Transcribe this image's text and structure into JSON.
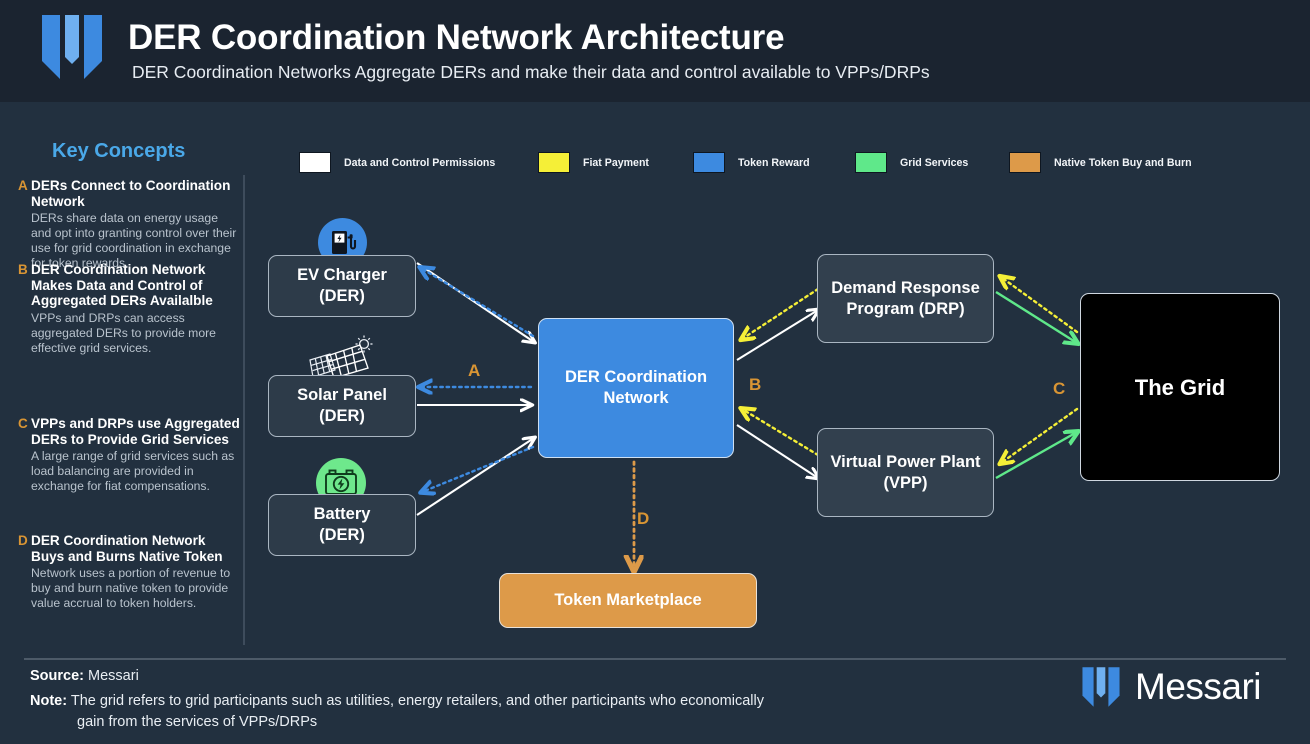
{
  "header": {
    "title": "DER Coordination Network Architecture",
    "subtitle": "DER Coordination Networks Aggregate DERs and make their data and control available to VPPs/DRPs",
    "logo_icon": "messari-logo-icon"
  },
  "sidebar": {
    "title": "Key Concepts",
    "concepts": [
      {
        "letter": "A",
        "heading": "DERs Connect to Coordination Network",
        "body": "DERs share data on energy usage and opt into granting control over their use for grid coordination in exchange for token rewards."
      },
      {
        "letter": "B",
        "heading": "DER Coordination Network Makes Data and Control of Aggregated DERs Availalble",
        "body": "VPPs and DRPs can access aggregated DERs to provide more effective grid services."
      },
      {
        "letter": "C",
        "heading": "VPPs and DRPs use Aggregated DERs to Provide Grid Services",
        "body": "A large range of grid services such as load balancing are provided in exchange for fiat compensations."
      },
      {
        "letter": "D",
        "heading": "DER Coordination Network Buys and Burns Native Token",
        "body": "Network uses a portion of revenue to buy and burn native token to provide value accrual to token holders."
      }
    ]
  },
  "legend": {
    "items": [
      {
        "label": "Data and Control Permissions",
        "color": "#ffffff"
      },
      {
        "label": "Fiat Payment",
        "color": "#f5ef37"
      },
      {
        "label": "Token Reward",
        "color": "#3d8ae0"
      },
      {
        "label": "Grid Services",
        "color": "#5fe88a"
      },
      {
        "label": "Native Token Buy and Burn",
        "color": "#dd9a49"
      }
    ]
  },
  "diagram": {
    "nodes": {
      "ev_charger": {
        "label": "EV Charger\n(DER)",
        "line1": "EV Charger",
        "line2": "(DER)",
        "icon": "ev-charger-icon"
      },
      "solar_panel": {
        "label": "Solar Panel\n(DER)",
        "line1": "Solar Panel",
        "line2": "(DER)",
        "icon": "solar-panel-icon"
      },
      "battery": {
        "label": "Battery\n(DER)",
        "line1": "Battery",
        "line2": "(DER)",
        "icon": "battery-icon"
      },
      "coordination_network": {
        "line1": "DER Coordination",
        "line2": "Network"
      },
      "drp": {
        "line1": "Demand Response",
        "line2": "Program (DRP)"
      },
      "vpp": {
        "line1": "Virtual Power Plant",
        "line2": "(VPP)"
      },
      "grid": {
        "line1": "The Grid"
      },
      "token_marketplace": {
        "line1": "Token Marketplace"
      }
    },
    "step_labels": [
      {
        "letter": "A"
      },
      {
        "letter": "B"
      },
      {
        "letter": "C"
      },
      {
        "letter": "D"
      }
    ]
  },
  "footer": {
    "source_label": "Source:",
    "source_value": "Messari",
    "note_label": "Note:",
    "note_line1": "The grid refers to grid participants such as utilities, energy retailers, and other participants who economically",
    "note_line2": "gain from the services of VPPs/DRPs",
    "brand": "Messari",
    "brand_icon": "messari-logo-icon"
  }
}
